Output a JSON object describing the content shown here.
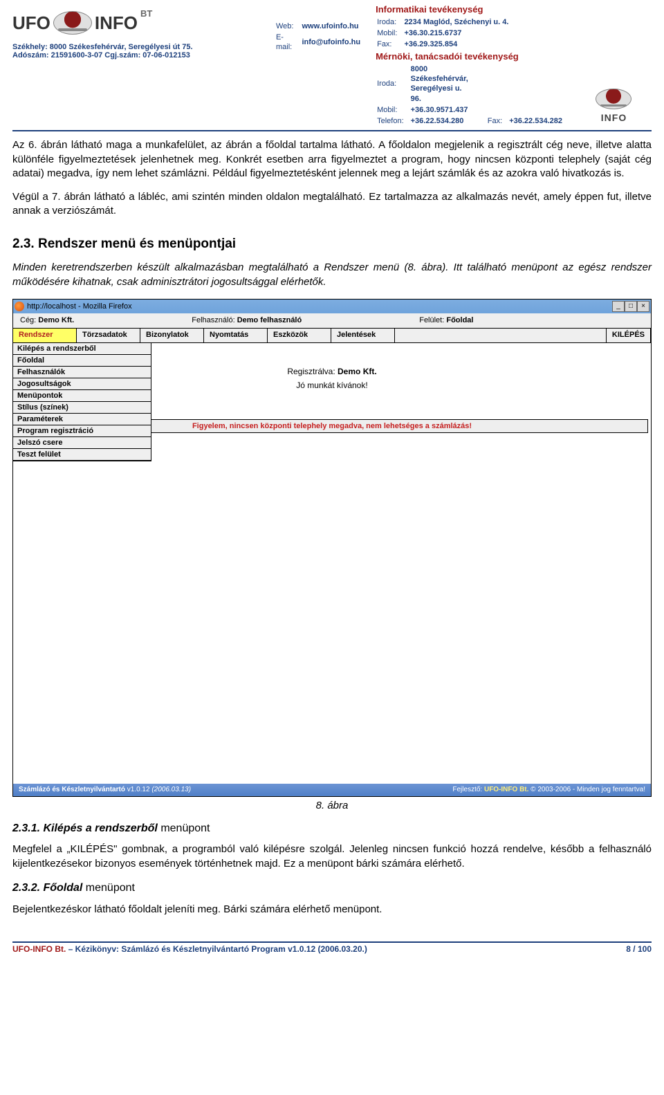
{
  "header": {
    "logo_ufo": "UFO",
    "logo_info": "INFO",
    "logo_bt": "BT",
    "seat_line": "Székhely: 8000 Székesfehérvár, Seregélyesi út 75.",
    "reg_line": "Adószám: 21591600-3-07  Cgj.szám: 07-06-012153",
    "web_label": "Web:",
    "web_value": "www.ufoinfo.hu",
    "email_label": "E-mail:",
    "email_value": "info@ufoinfo.hu",
    "it_title": "Informatikai tevékenység",
    "it_office_label": "Iroda:",
    "it_office_value": "2234 Maglód, Széchenyi u. 4.",
    "it_mobil_label": "Mobil:",
    "it_mobil_value": "+36.30.215.6737",
    "it_fax_label": "Fax:",
    "it_fax_value": "+36.29.325.854",
    "eng_title": "Mérnöki, tanácsadói tevékenység",
    "eng_office_label": "Iroda:",
    "eng_office_value": "8000 Székesfehérvár, Seregélyesi u. 96.",
    "eng_mobil_label": "Mobil:",
    "eng_mobil_value": "+36.30.9571.437",
    "eng_tel_label": "Telefon:",
    "eng_tel_value": "+36.22.534.280",
    "eng_fax_label": "Fax:",
    "eng_fax_value": "+36.22.534.282",
    "right_info": "INFO"
  },
  "body": {
    "p1": "Az 6. ábrán látható maga a munkafelület, az ábrán a főoldal tartalma látható. A főoldalon megjelenik a regisztrált cég neve, illetve alatta különféle figyelmeztetések jelenhetnek meg. Konkrét esetben arra figyelmeztet a program, hogy nincsen központi telephely (saját cég adatai) megadva, így nem lehet számlázni. Például figyelmeztetésként jelennek meg a lejárt számlák és az azokra való hivatkozás is.",
    "p2": "Végül a 7. ábrán látható a lábléc, ami szintén minden oldalon megtalálható. Ez tartalmazza az alkalmazás nevét, amely éppen fut, illetve annak a verziószámát.",
    "h2": "2.3. Rendszer menü és menüpontjai",
    "p3": "Minden keretrendszerben készült alkalmazásban megtalálható a Rendszer menü (8. ábra). Itt található menüpont az egész rendszer működésére kihatnak, csak adminisztrátori jogosultsággal elérhetők.",
    "figcap": "8. ábra",
    "h3a": "2.3.1. Kilépés a rendszerből",
    "h3a_suffix": " menüpont",
    "p4": "Megfelel a „KILÉPÉS\" gombnak, a programból való kilépésre szolgál. Jelenleg nincsen funkció hozzá rendelve, később a felhasználó kijelentkezésekor bizonyos események történhetnek majd. Ez a menüpont bárki számára elérhető.",
    "h3b": "2.3.2. Főoldal",
    "h3b_suffix": " menüpont",
    "p5": "Bejelentkezéskor látható főoldalt jeleníti meg. Bárki számára elérhető menüpont."
  },
  "screenshot": {
    "title": "http://localhost - Mozilla Firefox",
    "win_min": "_",
    "win_max": "□",
    "win_close": "×",
    "status_ceg_label": "Cég: ",
    "status_ceg_value": "Demo Kft.",
    "status_user_label": "Felhasználó: ",
    "status_user_value": "Demo felhasználó",
    "status_area_label": "Felület: ",
    "status_area_value": "Főoldal",
    "menu": [
      "Rendszer",
      "Törzsadatok",
      "Bizonylatok",
      "Nyomtatás",
      "Eszközök",
      "Jelentések"
    ],
    "menu_exit": "KILÉPÉS",
    "dropdown": [
      "Kilépés a rendszerből",
      "Főoldal",
      "Felhasználók",
      "Jogosultságok",
      "Menüpontok",
      "Stílus (színek)",
      "Paraméterek",
      "Program regisztráció",
      "Jelszó csere",
      "Teszt felület"
    ],
    "center_reg_label": "Regisztrálva: ",
    "center_reg_value": "Demo Kft.",
    "center_greet": "Jó munkát kívánok!",
    "warning": "Figyelem, nincsen központi telephely megadva, nem lehetséges a számlázás!",
    "footer_left_a": "Számlázó és Készletnyilvántartó",
    "footer_left_b": " v1.0.12 ",
    "footer_left_c": "(2006.03.13)",
    "footer_right_a": "Fejlesztő: ",
    "footer_right_b": "UFO-INFO Bt.",
    "footer_right_c": " © 2003-2006 - Minden jog fenntartva!"
  },
  "pagefooter": {
    "left_red": "UFO-INFO Bt.",
    "left_rest": " – Kézikönyv: Számlázó és Készletnyilvántartó Program v1.0.12 (2006.03.20.)",
    "right": "8 / 100"
  }
}
